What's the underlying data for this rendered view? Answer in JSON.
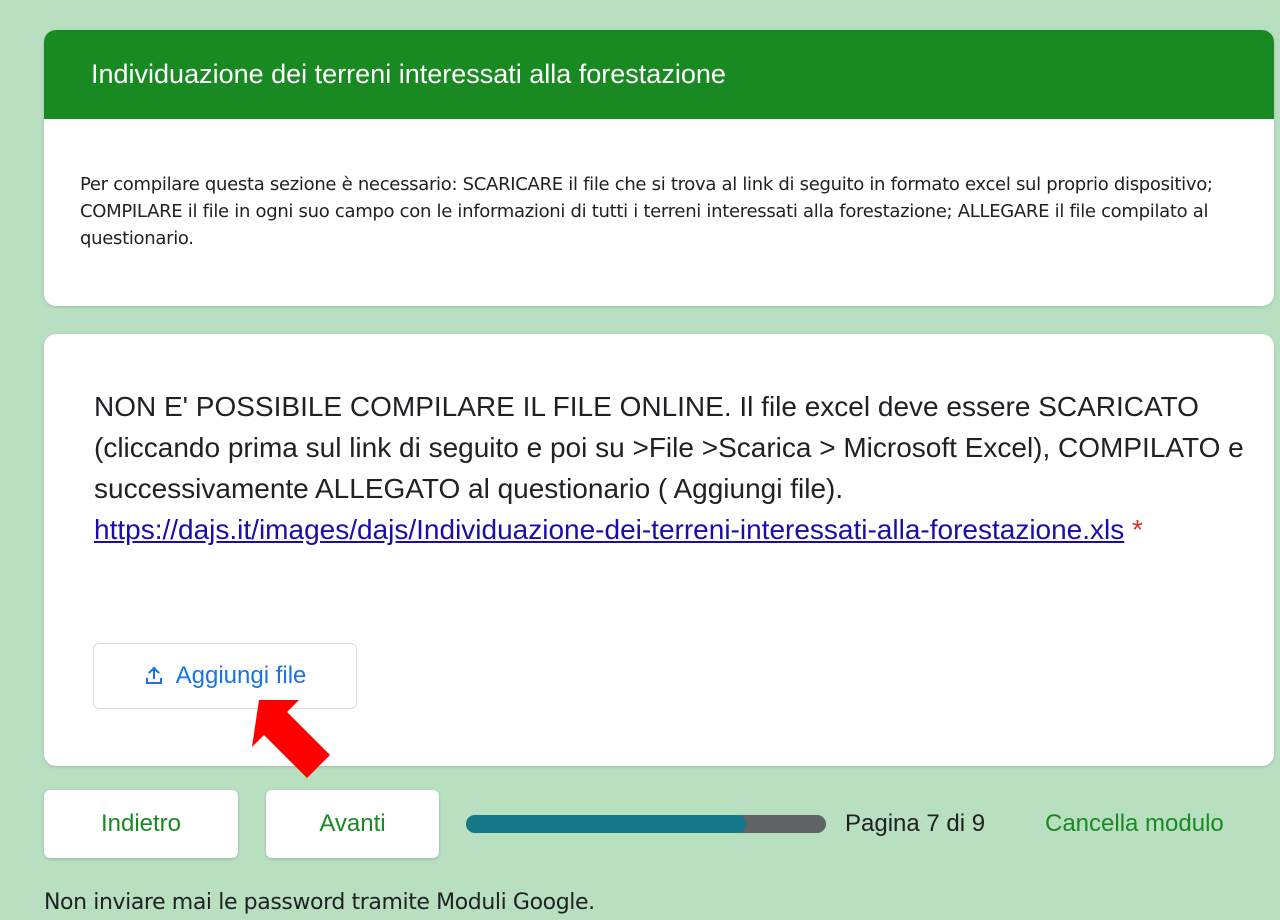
{
  "section": {
    "title": "Individuazione dei terreni interessati alla forestazione",
    "description": "Per compilare questa sezione è necessario: SCARICARE il file che si trova al link di seguito in  formato excel sul proprio dispositivo; COMPILARE il file in ogni suo campo con le informazioni di tutti i terreni interessati alla forestazione; ALLEGARE il file compilato al questionario.",
    "header_color": "#188a21"
  },
  "question": {
    "text": "NON E' POSSIBILE COMPILARE IL FILE ONLINE. Il file excel deve essere SCARICATO (cliccando prima sul link di seguito e poi su >File >Scarica > Microsoft Excel), COMPILATO e successivamente ALLEGATO al questionario ( Aggiungi file). ",
    "link_text": "https://dajs.it/images/dajs/Individuazione-dei-terreni-interessati-alla-forestazione.xls",
    "required_mark": " *",
    "upload_icon": "upload-icon",
    "upload_label": "Aggiungi file"
  },
  "annotation": {
    "icon": "red-arrow-icon",
    "color": "#ff0000"
  },
  "navigation": {
    "back_label": "Indietro",
    "next_label": "Avanti",
    "progress_fraction": 0.7778,
    "page_indicator": "Pagina 7 di 9",
    "clear_label": "Cancella modulo"
  },
  "footer": {
    "warning": "Non inviare mai le password tramite Moduli Google."
  },
  "colors": {
    "background": "#b9dfc1",
    "accent": "#188a21",
    "link": "#1a0dab",
    "button_text": "#1a73e8",
    "required": "#d93025",
    "progress_fill": "#15788a",
    "progress_track": "#5f6368"
  }
}
